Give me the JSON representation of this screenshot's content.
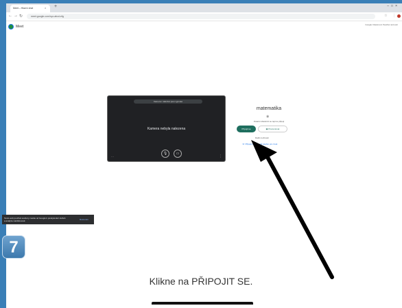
{
  "browser": {
    "tab_title": "Meet – Hlavní chat",
    "url": "meet.google.com/xyz-abcd-efg",
    "tab_close": "×",
    "tab_add": "+"
  },
  "meet": {
    "app_name": "Meet",
    "account": "Google Classroom\nTeacher account"
  },
  "preview": {
    "banner": "Kamera i mikrofon jsou vypnuté",
    "camera_off_text": "Kamera nebyla nalezena",
    "mic_icon": "mic-off-icon",
    "cam_icon": "camera-off-icon"
  },
  "join_panel": {
    "meeting_name": "matematika",
    "status_text": "Ostatní účastníci se teprve připojí",
    "join_label": "Připojit se",
    "present_label": "Prezentovat",
    "other_options_label": "Další možnosti",
    "option_1": "Připojit se a použít telefon pro zvuk"
  },
  "snackbar": {
    "text": "Tento web používá soubory cookie od Googlu k poskytování služeb a analýze návštěvnosti.",
    "button": "Rozumím"
  },
  "step": {
    "number": "7"
  },
  "caption": "Klikne na PŘIPOJIT SE."
}
